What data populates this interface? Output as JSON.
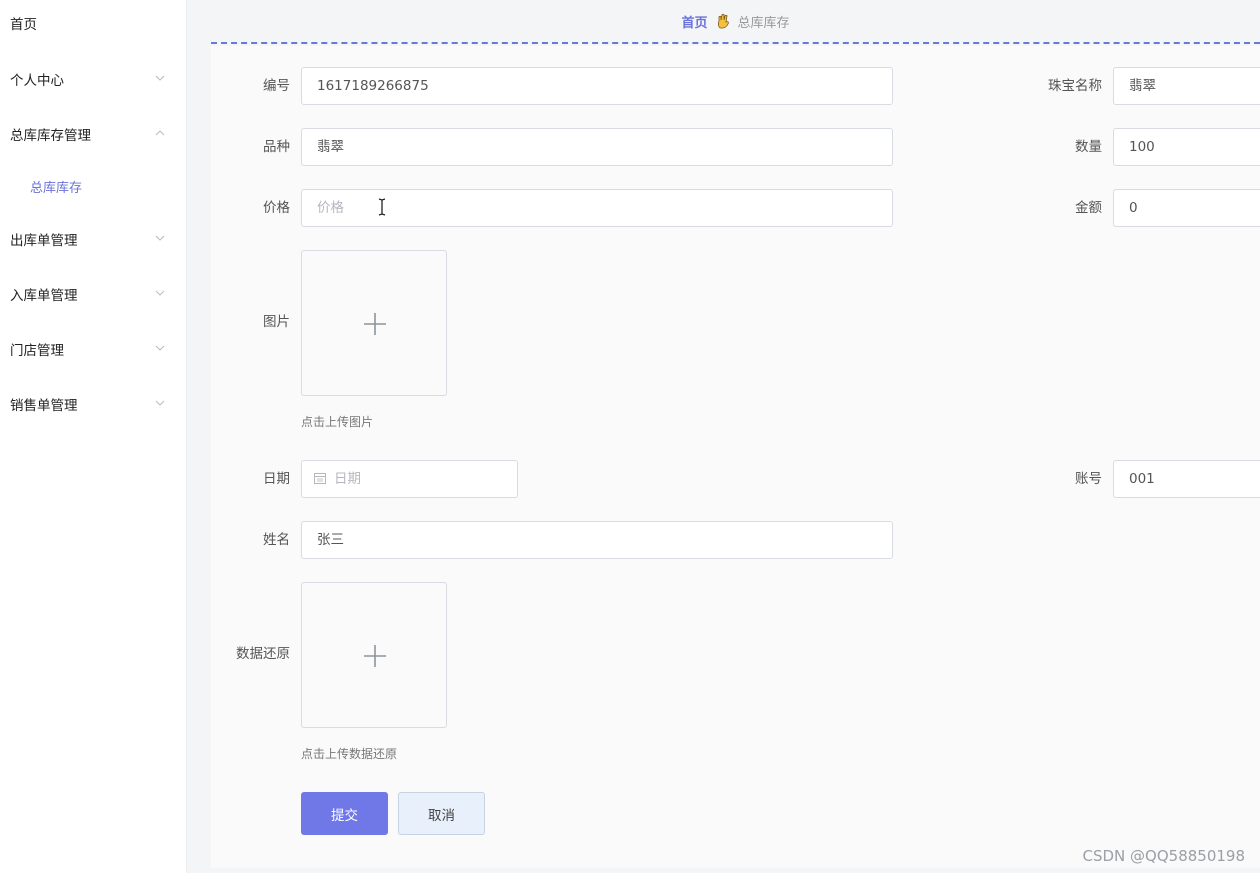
{
  "sidebar": {
    "items": [
      {
        "label": "首页"
      },
      {
        "label": "个人中心"
      },
      {
        "label": "总库库存管理"
      },
      {
        "label": "出库单管理"
      },
      {
        "label": "入库单管理"
      },
      {
        "label": "门店管理"
      },
      {
        "label": "销售单管理"
      }
    ],
    "sub_item": "总库库存"
  },
  "breadcrumb": {
    "home": "首页",
    "current": "总库库存",
    "separator_icon": "hand-icon"
  },
  "form": {
    "bianhao": {
      "label": "编号",
      "value": "1617189266875"
    },
    "name": {
      "label": "珠宝名称",
      "value": "翡翠"
    },
    "pinzhong": {
      "label": "品种",
      "value": "翡翠"
    },
    "shuliang": {
      "label": "数量",
      "value": "100"
    },
    "jiage": {
      "label": "价格",
      "placeholder": "价格"
    },
    "jine": {
      "label": "金额",
      "value": "0"
    },
    "tupian": {
      "label": "图片",
      "hint": "点击上传图片"
    },
    "riqi": {
      "label": "日期",
      "placeholder": "日期"
    },
    "zhanghao": {
      "label": "账号",
      "value": "001"
    },
    "xingming": {
      "label": "姓名",
      "value": "张三"
    },
    "restore": {
      "label": "数据还原",
      "hint": "点击上传数据还原"
    },
    "submit": "提交",
    "cancel": "取消"
  },
  "watermark": "CSDN @QQ58850198",
  "colors": {
    "accent": "#7078e8",
    "breadcrumb_line": "#6a79d9"
  }
}
